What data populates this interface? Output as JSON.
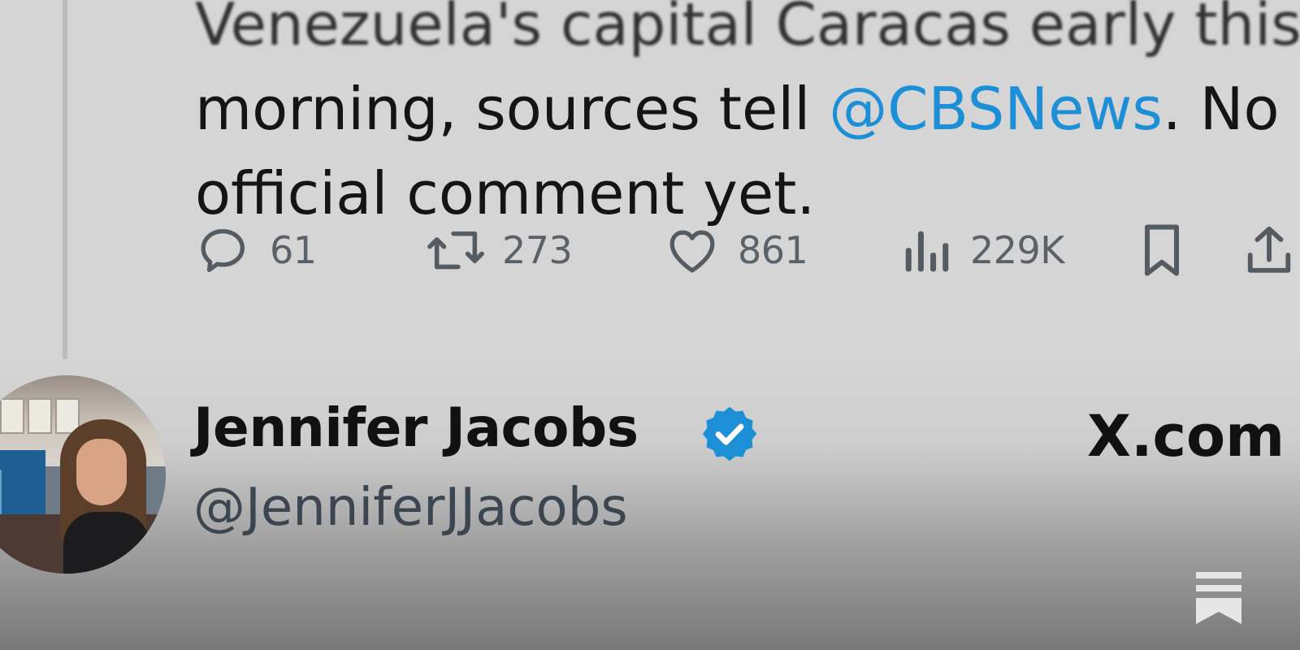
{
  "tweet": {
    "line_top_partial": "Venezuela's capital Caracas early this",
    "line_2_prefix": "morning, sources tell ",
    "line_2_mention": "@CBSNews",
    "line_2_suffix": ". No",
    "line_3": "official comment yet."
  },
  "actions": {
    "replies": "61",
    "retweets": "273",
    "likes": "861",
    "views": "229K"
  },
  "author": {
    "name": "Jennifer Jacobs",
    "handle": "@JenniferJJacobs",
    "verified": true
  },
  "source": {
    "label": "X.com"
  },
  "colors": {
    "mention": "#1d8fd6",
    "verified_badge": "#1d8fd6",
    "background": "#d5d5d5"
  },
  "icons": {
    "reply": "reply-icon",
    "retweet": "retweet-icon",
    "like": "heart-icon",
    "views": "views-icon",
    "bookmark": "bookmark-icon",
    "share": "share-icon",
    "verified": "verified-badge-icon",
    "substack": "substack-bookmark-icon"
  }
}
